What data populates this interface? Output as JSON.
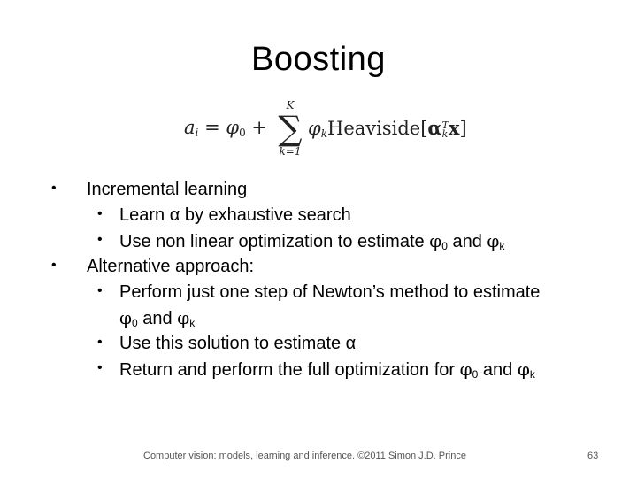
{
  "slide": {
    "title": "Boosting",
    "equation": {
      "lhs": "a",
      "lhs_sub": "i",
      "equals": "=",
      "phi0": "φ",
      "phi0_sub": "0",
      "plus": "+",
      "sum_upper": "K",
      "sum_symbol": "∑",
      "sum_lower": "k=1",
      "phik": "φ",
      "phik_sub": "k",
      "func": "Heaviside[",
      "alpha": "α",
      "alpha_sup": "T",
      "alpha_sub": "k",
      "x": "x",
      "close": "]"
    },
    "bullets": [
      {
        "level": 1,
        "text": "Incremental learning"
      },
      {
        "level": 2,
        "text": "Learn α by exhaustive search"
      },
      {
        "level": 2,
        "text_before": "Use non linear optimization to estimate ",
        "sym1": "φ",
        "sub1": "0",
        "mid": " and ",
        "sym2": "φ",
        "sub2": "k"
      },
      {
        "level": 1,
        "text": "Alternative approach:"
      },
      {
        "level": 2,
        "text": "Perform just one step of Newton’s method to estimate"
      },
      {
        "level": 2,
        "continuation": true,
        "sym1": "φ",
        "sub1": "0",
        "mid": " and ",
        "sym2": "φ",
        "sub2": "k"
      },
      {
        "level": 2,
        "text": "Use this solution to estimate α"
      },
      {
        "level": 2,
        "text_before": "Return and perform the full optimization for ",
        "sym1": "φ",
        "sub1": "0",
        "mid": " and ",
        "sym2": "φ",
        "sub2": "k"
      }
    ],
    "bullet_glyph": "•",
    "footer": {
      "credit": "Computer vision: models, learning and inference.  ©2011 Simon J.D. Prince",
      "page_number": "63"
    }
  }
}
